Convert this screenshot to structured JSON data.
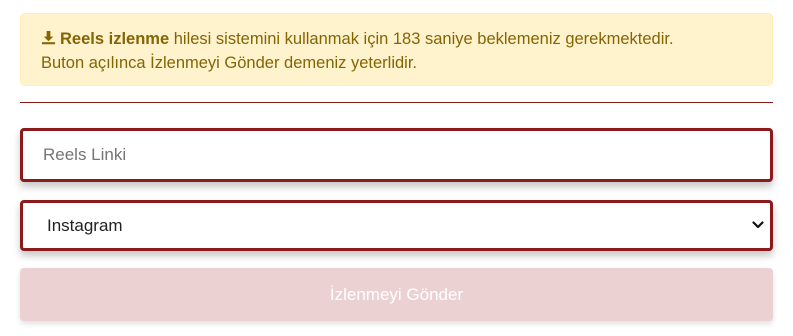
{
  "alert": {
    "icon": "download-icon",
    "bold_text": "Reels izlenme",
    "text_part1": " hilesi sistemini kullanmak için 183 saniye beklemeniz gerekmektedir.",
    "text_part2": "Buton açılınca İzlenmeyi Gönder demeniz yeterlidir.",
    "colors": {
      "background": "#fff3cd",
      "text": "#856404",
      "border": "#ffeeba"
    }
  },
  "form": {
    "reels_link": {
      "placeholder": "Reels Linki",
      "value": ""
    },
    "platform_select": {
      "selected": "Instagram",
      "icon": "chevron-down-icon"
    },
    "submit_button": {
      "label": "İzlenmeyi Gönder",
      "state": "disabled"
    },
    "colors": {
      "accent": "#8b1a1a",
      "button_disabled": "#ebd1d2"
    }
  }
}
